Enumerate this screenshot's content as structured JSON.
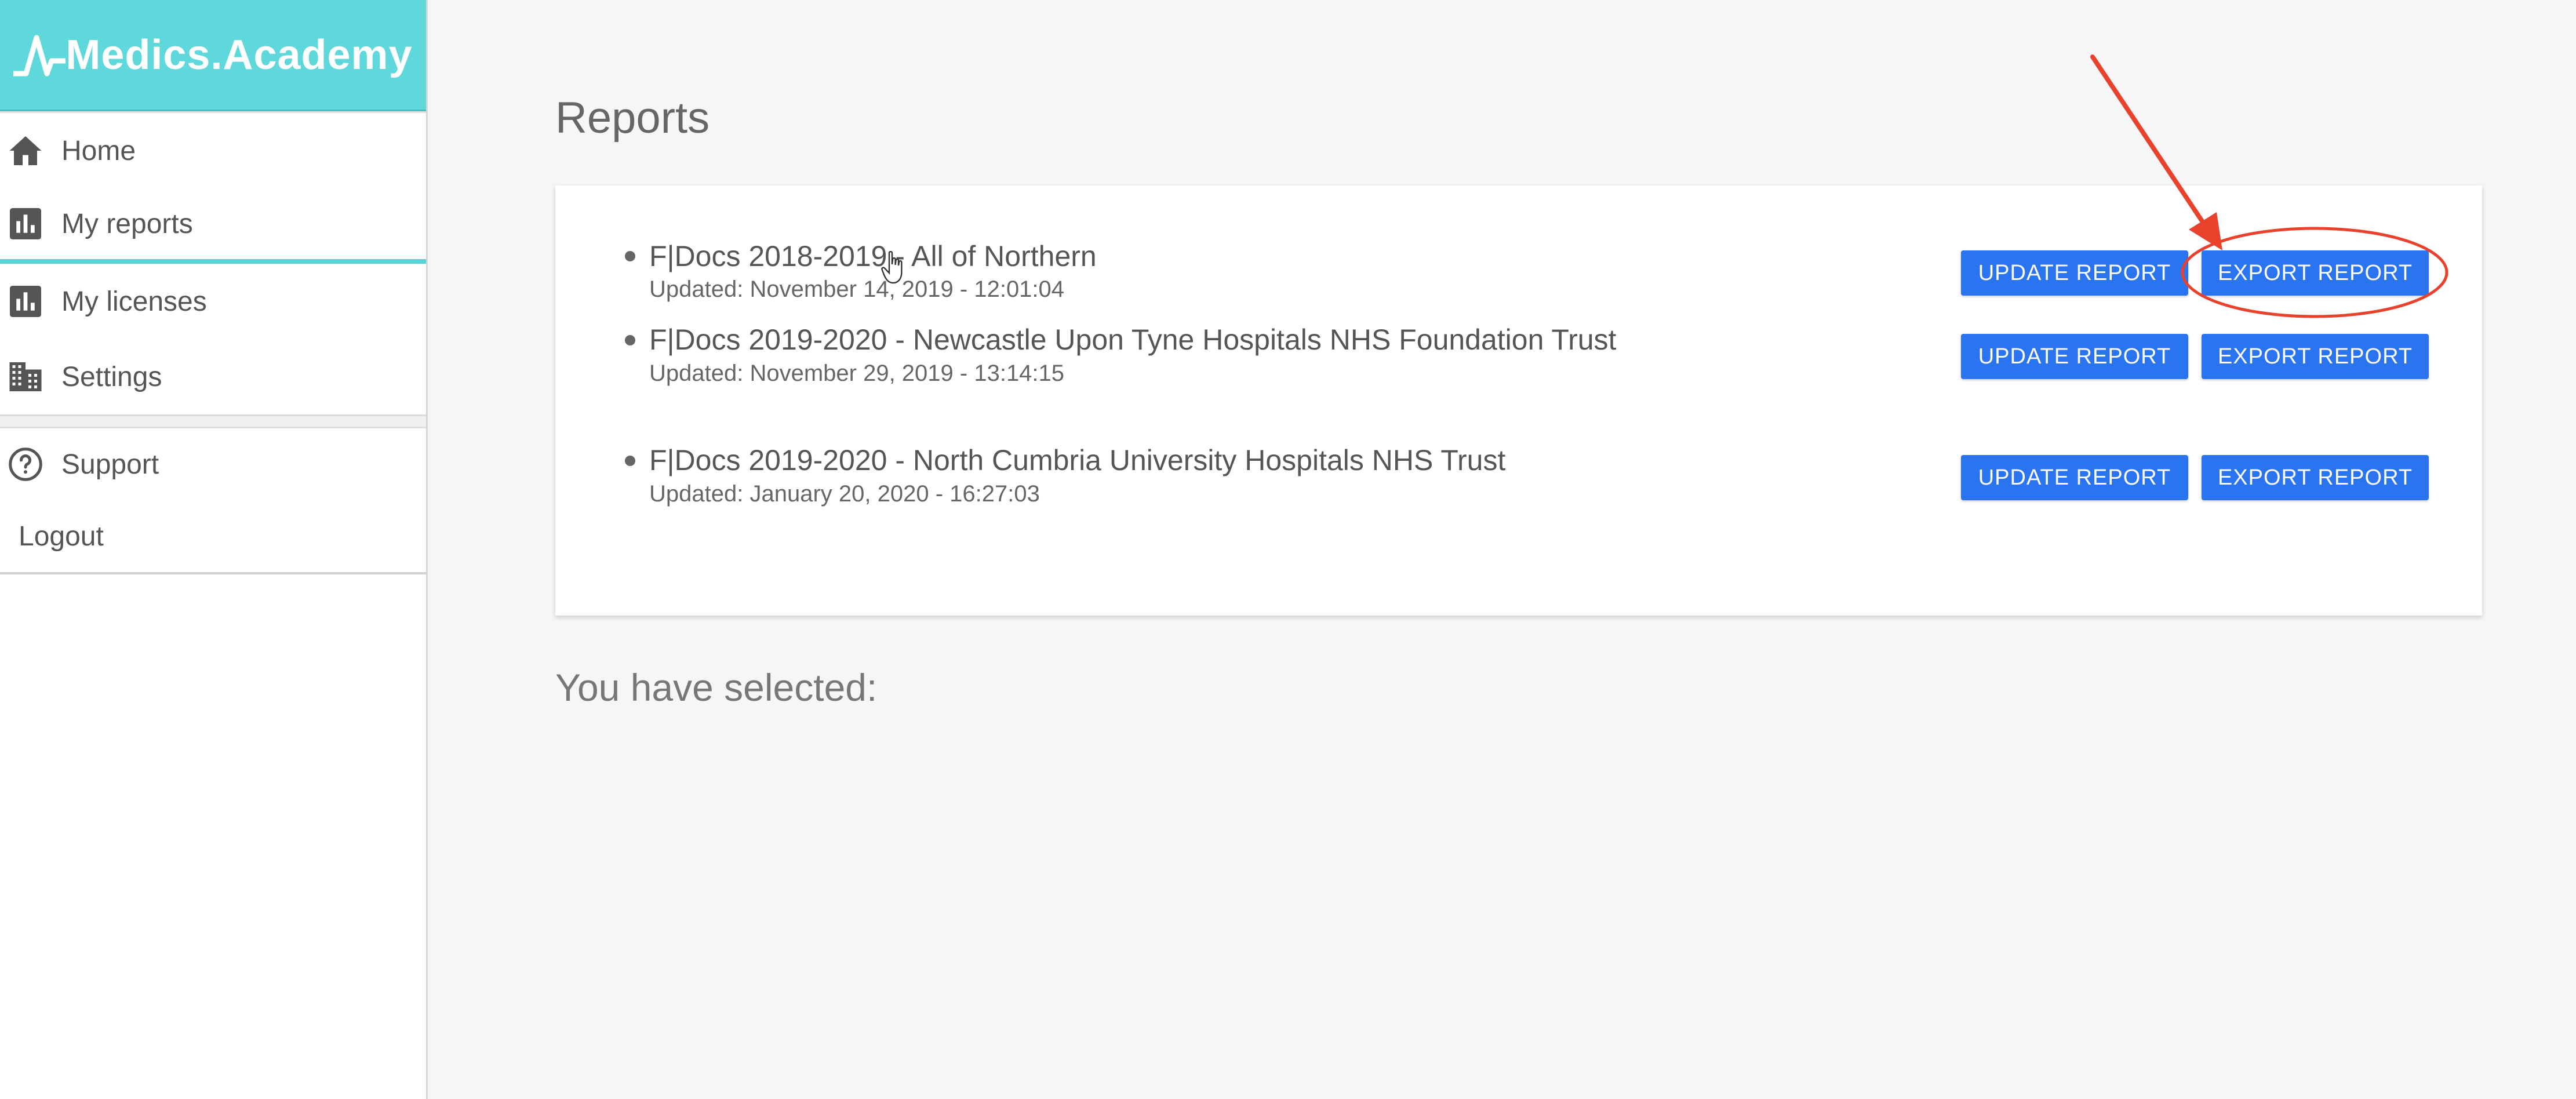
{
  "brand": {
    "name": "Medics.Academy",
    "color": "#5fd8dc"
  },
  "sidebar": {
    "items": [
      {
        "label": "Home",
        "icon": "home-icon"
      },
      {
        "label": "My reports",
        "icon": "bar-chart-icon",
        "active": true
      },
      {
        "label": "My licenses",
        "icon": "bar-chart-icon"
      },
      {
        "label": "Settings",
        "icon": "building-icon"
      }
    ],
    "support_label": "Support",
    "logout_label": "Logout"
  },
  "main": {
    "title": "Reports",
    "selected_label": "You have selected:",
    "reports": [
      {
        "title": "F|Docs 2018-2019 - All of Northern",
        "updated": "Updated: November 14, 2019 - 12:01:04",
        "update_label": "UPDATE REPORT",
        "export_label": "EXPORT REPORT"
      },
      {
        "title": "F|Docs 2019-2020 - Newcastle Upon Tyne Hospitals NHS Foundation Trust",
        "updated": "Updated: November 29, 2019 - 13:14:15",
        "update_label": "UPDATE REPORT",
        "export_label": "EXPORT REPORT"
      },
      {
        "title": "F|Docs 2019-2020 - North Cumbria University Hospitals NHS Trust",
        "updated": "Updated: January 20, 2020 - 16:27:03",
        "update_label": "UPDATE REPORT",
        "export_label": "EXPORT REPORT"
      }
    ]
  },
  "colors": {
    "accent": "#2a74f0",
    "annotation": "#e8412c",
    "active_underline": "#55d3d6"
  }
}
